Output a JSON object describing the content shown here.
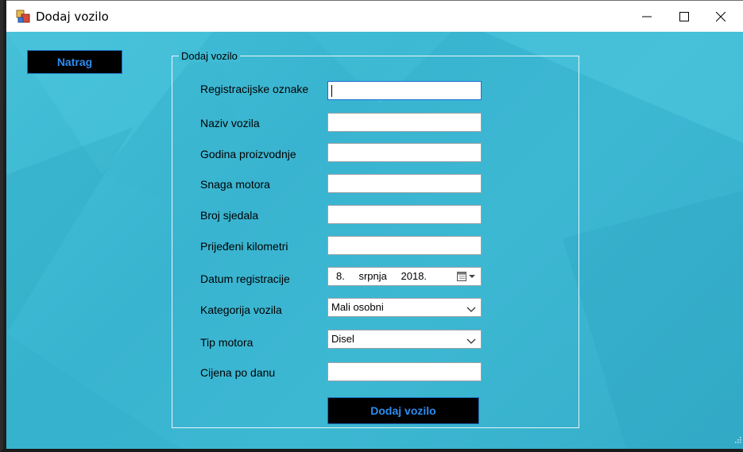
{
  "window": {
    "title": "Dodaj vozilo"
  },
  "toolbar": {
    "back_label": "Natrag"
  },
  "form": {
    "group_title": "Dodaj vozilo",
    "fields": [
      {
        "label": "Registracijske oznake",
        "value": ""
      },
      {
        "label": "Naziv vozila",
        "value": ""
      },
      {
        "label": "Godina proizvodnje",
        "value": ""
      },
      {
        "label": "Snaga motora",
        "value": ""
      },
      {
        "label": "Broj sjedala",
        "value": ""
      },
      {
        "label": "Prijeđeni kilometri",
        "value": ""
      },
      {
        "label": "Datum registracije",
        "day": "8.",
        "month": "srpnja",
        "year": "2018."
      },
      {
        "label": "Kategorija vozila",
        "value": "Mali osobni"
      },
      {
        "label": "Tip motora",
        "value": "Disel"
      },
      {
        "label": "Cijena po danu",
        "value": ""
      }
    ],
    "submit_label": "Dodaj vozilo"
  },
  "colors": {
    "background": "#3cb8d3",
    "button_bg": "#000000",
    "button_text": "#2d8cf0"
  },
  "icons": [
    "app-icon",
    "minimize-icon",
    "maximize-icon",
    "close-icon",
    "calendar-icon",
    "chevron-down-icon",
    "resize-grip-icon"
  ]
}
